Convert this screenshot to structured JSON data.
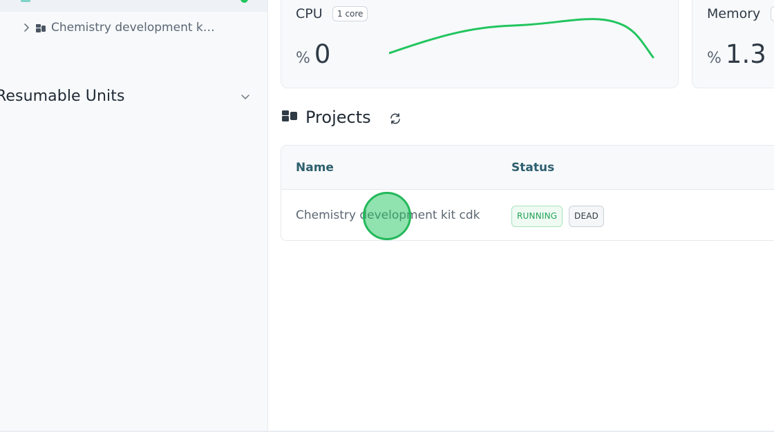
{
  "sidebar": {
    "tree_item": {
      "label": "Chemistry development k…",
      "icon": "project-icon"
    },
    "section": {
      "title": "Resumable Units",
      "icon": "chevron-down-icon"
    }
  },
  "metrics": {
    "cpu": {
      "title": "CPU",
      "badge": "1 core",
      "unit": "%",
      "value": "0"
    },
    "memory": {
      "title": "Memory",
      "badge": "",
      "unit": "%",
      "value": "1.3"
    }
  },
  "projects": {
    "title": "Projects",
    "refresh_icon": "refresh-icon",
    "columns": {
      "name": "Name",
      "status": "Status"
    },
    "rows": [
      {
        "name": "Chemistry development kit cdk",
        "status_running": "RUNNING",
        "status_dead": "DEAD"
      }
    ]
  },
  "colors": {
    "accent_green": "#22c55e",
    "header_text": "#2d5f6e",
    "running_text": "#22a356"
  }
}
